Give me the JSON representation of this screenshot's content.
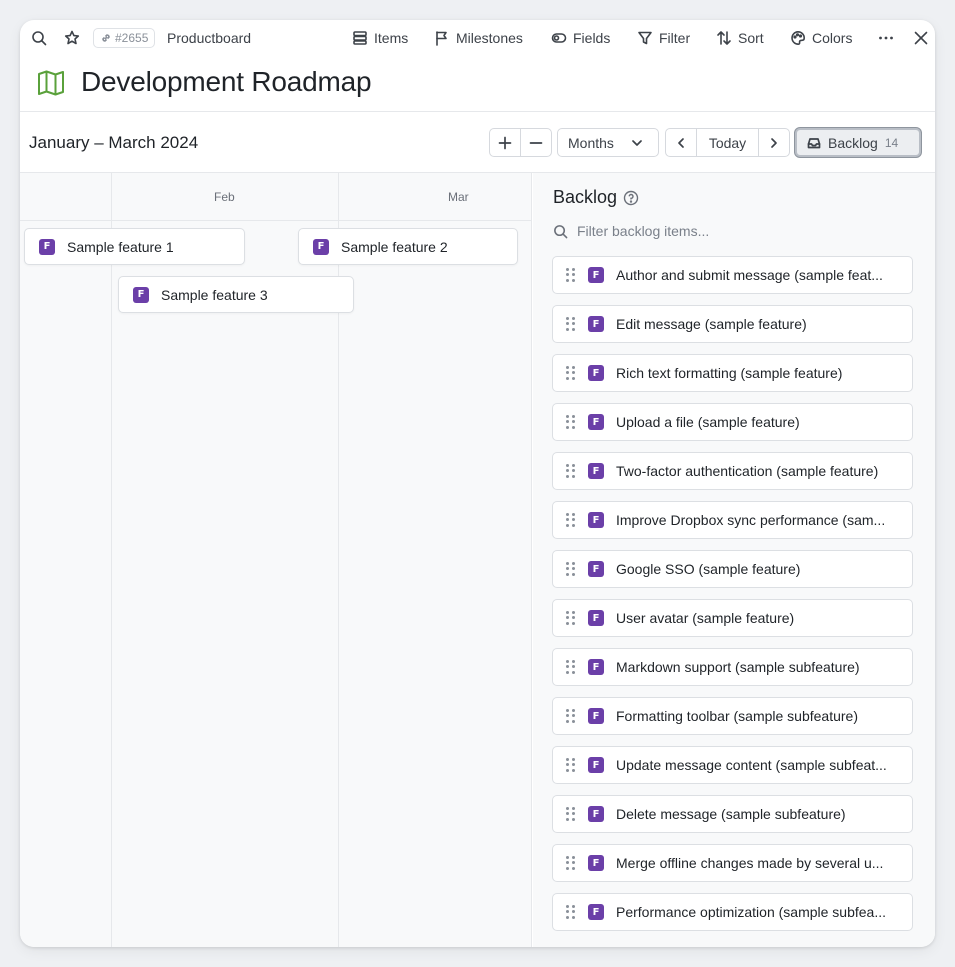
{
  "topbar": {
    "item_id": "#2655",
    "workspace": "Productboard",
    "menu": [
      {
        "label": "Items",
        "icon": "stack-icon"
      },
      {
        "label": "Milestones",
        "icon": "flag-icon"
      },
      {
        "label": "Fields",
        "icon": "toggle-icon"
      },
      {
        "label": "Filter",
        "icon": "filter-icon"
      },
      {
        "label": "Sort",
        "icon": "sort-icon"
      },
      {
        "label": "Colors",
        "icon": "palette-icon"
      }
    ]
  },
  "page": {
    "title": "Development Roadmap",
    "icon": "map-icon"
  },
  "toolbar": {
    "date_range": "January – March 2024",
    "zoom_unit": "Months",
    "today_label": "Today",
    "backlog_label": "Backlog",
    "backlog_count": "14"
  },
  "timeline": {
    "months": [
      "Feb",
      "Mar"
    ],
    "bars": [
      {
        "label": "Sample feature 1",
        "badge": "F"
      },
      {
        "label": "Sample feature 2",
        "badge": "F"
      },
      {
        "label": "Sample feature 3",
        "badge": "F"
      }
    ]
  },
  "backlog": {
    "title": "Backlog",
    "search_placeholder": "Filter backlog items...",
    "items": [
      {
        "label": "Author and submit message (sample feat...",
        "badge": "F"
      },
      {
        "label": "Edit message (sample feature)",
        "badge": "F"
      },
      {
        "label": "Rich text formatting (sample feature)",
        "badge": "F"
      },
      {
        "label": "Upload a file (sample feature)",
        "badge": "F"
      },
      {
        "label": "Two-factor authentication (sample feature)",
        "badge": "F"
      },
      {
        "label": "Improve Dropbox sync performance (sam...",
        "badge": "F"
      },
      {
        "label": "Google SSO (sample feature)",
        "badge": "F"
      },
      {
        "label": "User avatar (sample feature)",
        "badge": "F"
      },
      {
        "label": "Markdown support (sample subfeature)",
        "badge": "F"
      },
      {
        "label": "Formatting toolbar (sample subfeature)",
        "badge": "F"
      },
      {
        "label": "Update message content (sample subfeat...",
        "badge": "F"
      },
      {
        "label": "Delete message (sample subfeature)",
        "badge": "F"
      },
      {
        "label": "Merge offline changes made by several u...",
        "badge": "F"
      },
      {
        "label": "Performance optimization (sample subfea...",
        "badge": "F"
      }
    ]
  },
  "colors": {
    "feature_badge": "#6b3fa8",
    "map_icon": "#5aa13b"
  }
}
